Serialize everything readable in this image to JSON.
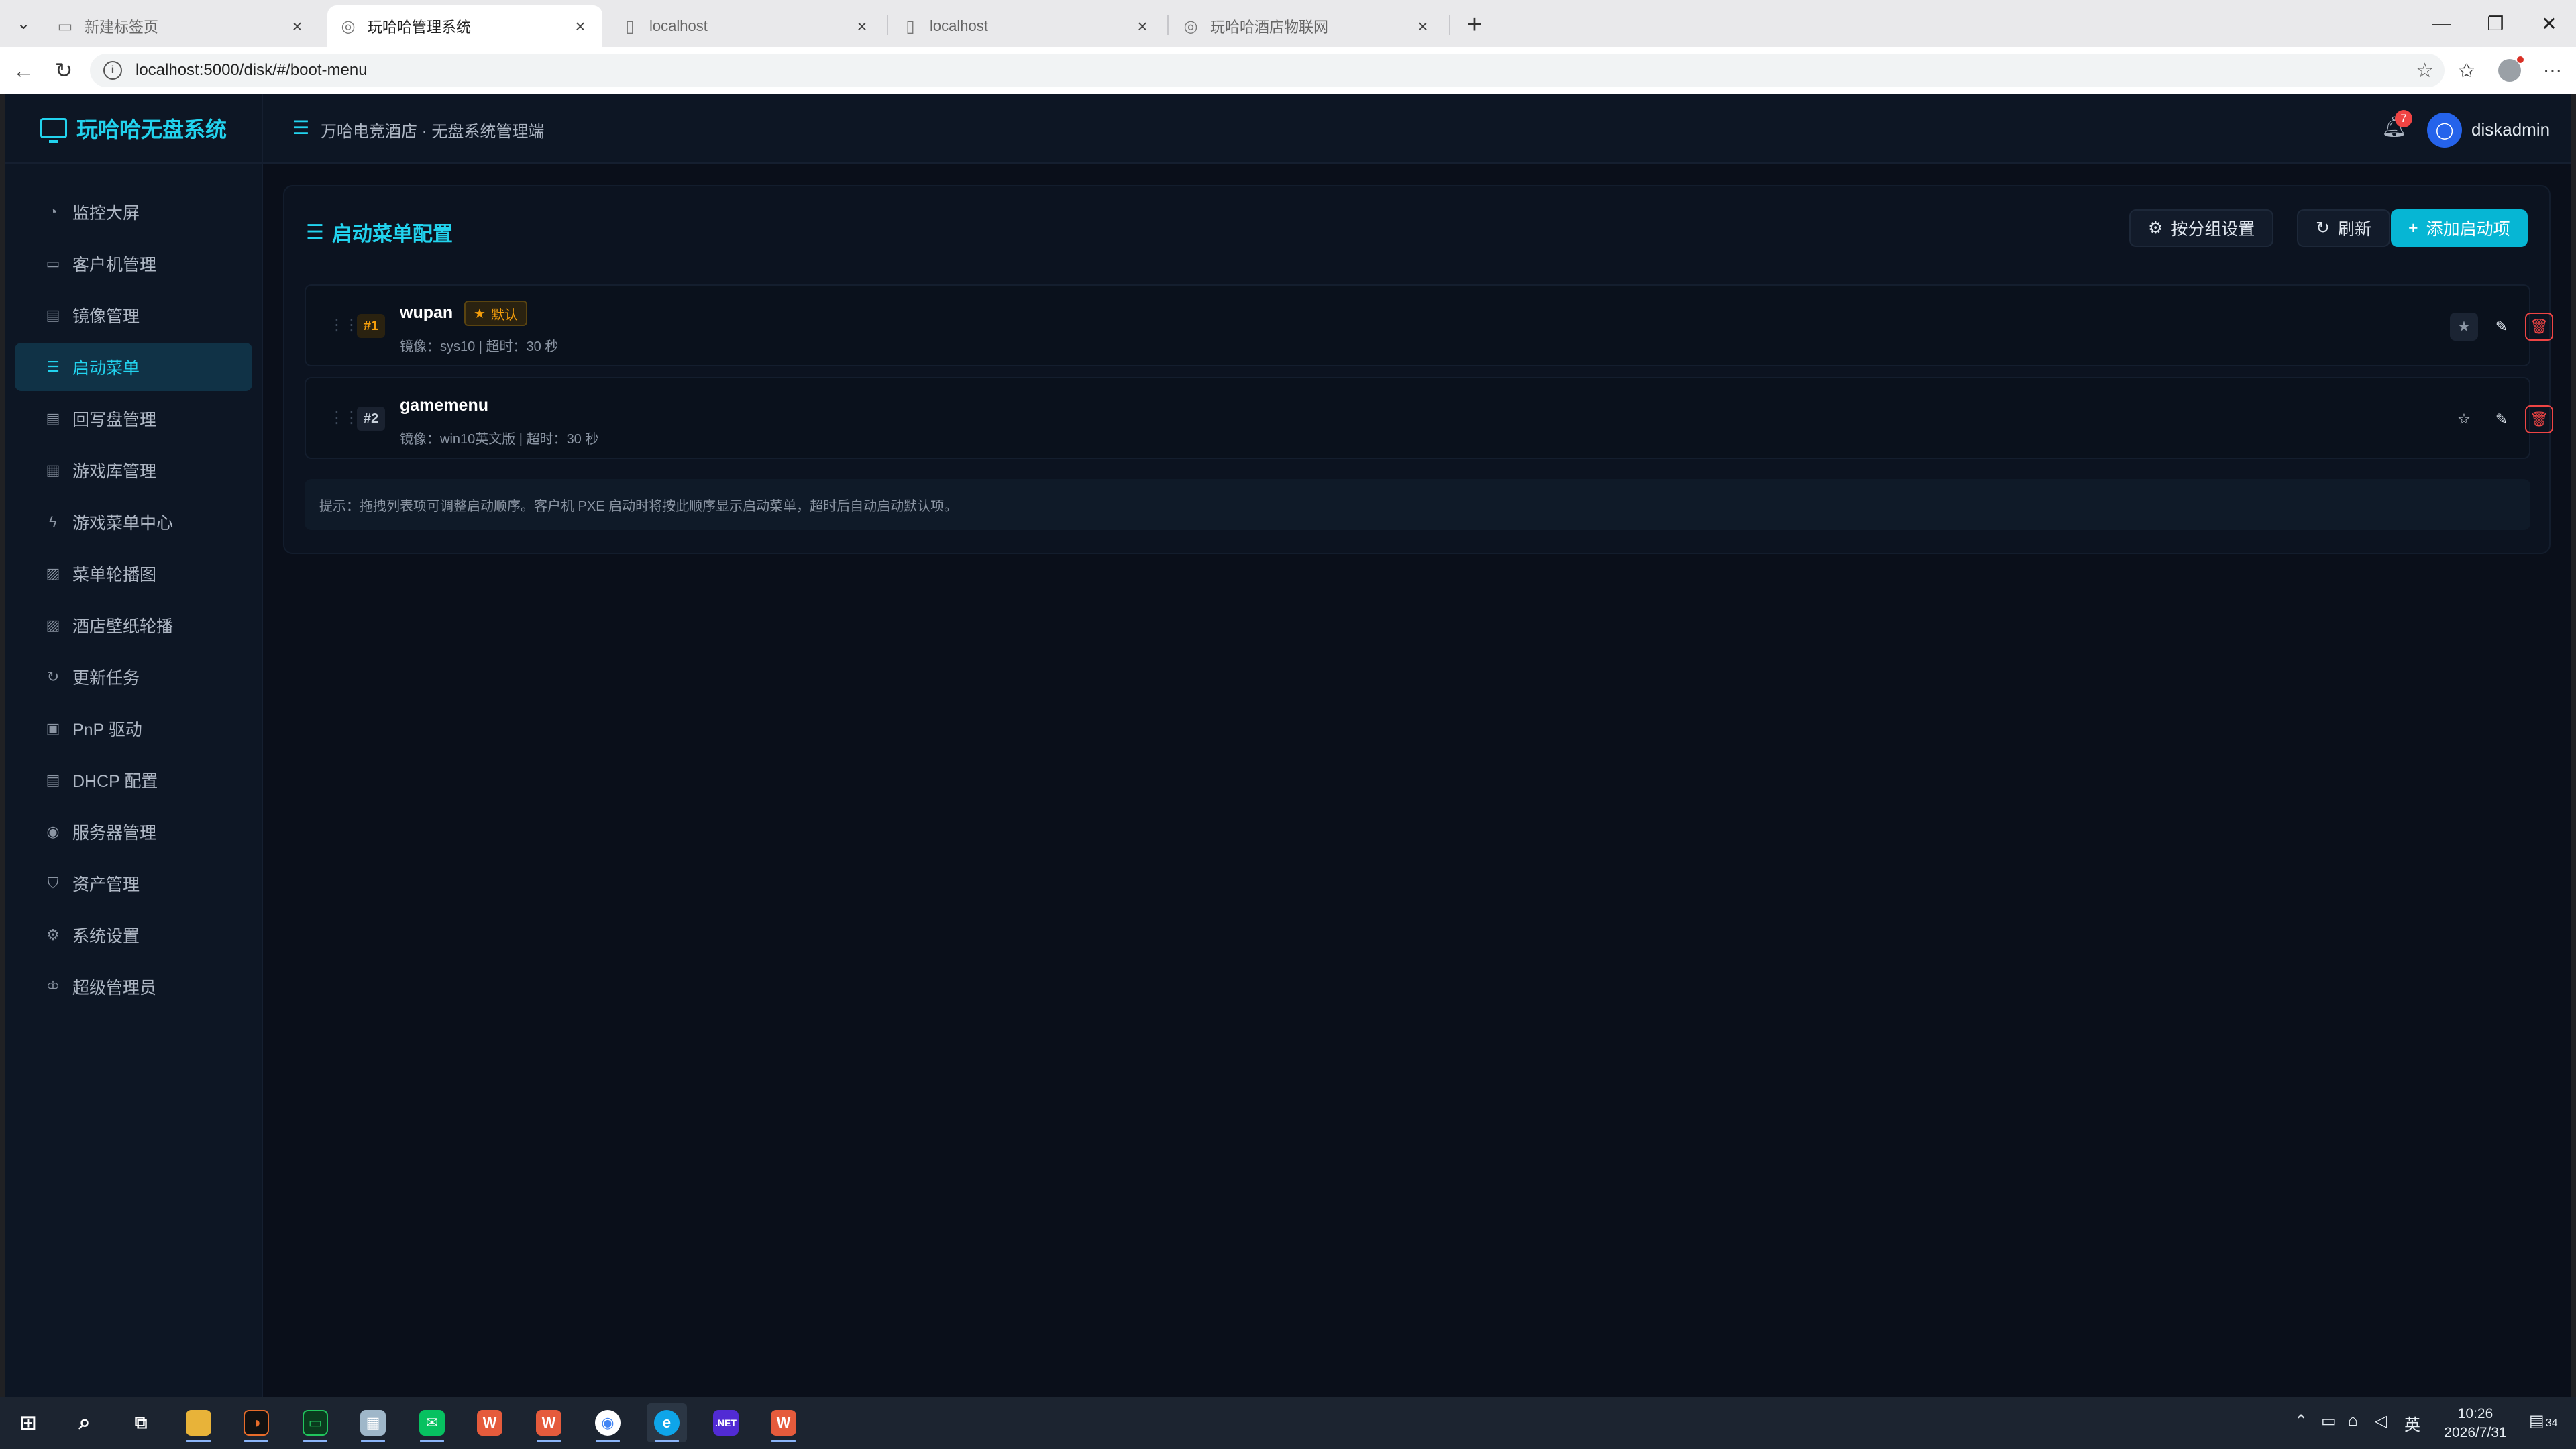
{
  "browser": {
    "tabs": [
      {
        "title": "新建标签页",
        "active": false
      },
      {
        "title": "玩哈哈管理系统",
        "active": true
      },
      {
        "title": "localhost",
        "active": false
      },
      {
        "title": "localhost",
        "active": false
      },
      {
        "title": "玩哈哈酒店物联网",
        "active": false
      }
    ],
    "url": "localhost:5000/disk/#/boot-menu"
  },
  "app": {
    "brand": "玩哈哈无盘系统",
    "breadcrumb": "万哈电竞酒店 · 无盘系统管理端",
    "notification_count": "7",
    "username": "diskadmin",
    "accent": "#22d3ee"
  },
  "sidebar": {
    "items": [
      {
        "label": "监控大屏",
        "icon": "dashboard-icon"
      },
      {
        "label": "客户机管理",
        "icon": "monitor-icon"
      },
      {
        "label": "镜像管理",
        "icon": "image-disk-icon"
      },
      {
        "label": "启动菜单",
        "icon": "list-icon",
        "active": true
      },
      {
        "label": "回写盘管理",
        "icon": "disk-icon"
      },
      {
        "label": "游戏库管理",
        "icon": "grid-icon"
      },
      {
        "label": "游戏菜单中心",
        "icon": "bolt-icon"
      },
      {
        "label": "菜单轮播图",
        "icon": "picture-icon"
      },
      {
        "label": "酒店壁纸轮播",
        "icon": "picture-icon"
      },
      {
        "label": "更新任务",
        "icon": "refresh-icon"
      },
      {
        "label": "PnP 驱动",
        "icon": "chip-icon"
      },
      {
        "label": "DHCP 配置",
        "icon": "server-icon"
      },
      {
        "label": "服务器管理",
        "icon": "eye-icon"
      },
      {
        "label": "资产管理",
        "icon": "shield-icon"
      },
      {
        "label": "系统设置",
        "icon": "gear-icon"
      },
      {
        "label": "超级管理员",
        "icon": "crown-icon"
      }
    ]
  },
  "page": {
    "title": "启动菜单配置",
    "buttons": {
      "group_settings": "按分组设置",
      "refresh": "刷新",
      "add": "添加启动项"
    },
    "items": [
      {
        "index": "#1",
        "name": "wupan",
        "default_label": "默认",
        "meta": "镜像：sys10 | 超时：30 秒",
        "is_default": true
      },
      {
        "index": "#2",
        "name": "gamemenu",
        "meta": "镜像：win10英文版 | 超时：30 秒",
        "is_default": false
      }
    ],
    "tip": "提示：拖拽列表项可调整启动顺序。客户机 PXE 启动时将按此顺序显示启动菜单，超时后自动启动默认项。"
  },
  "taskbar": {
    "time": "10:26",
    "date": "2026/7/31",
    "ime": "英",
    "notifications": "34"
  }
}
